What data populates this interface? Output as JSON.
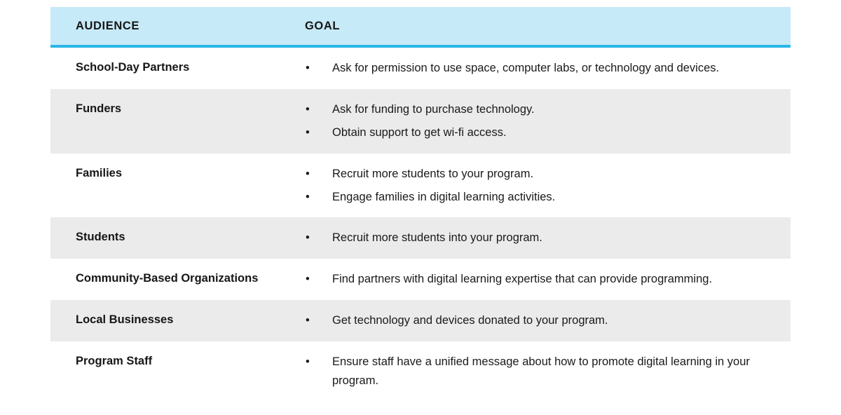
{
  "table": {
    "header": {
      "audience_label": "AUDIENCE",
      "goal_label": "GOAL",
      "background_color": "#c6eaf7",
      "accent_color": "#29b6e8"
    },
    "shaded_row_color": "#ebebeb",
    "bullet_glyph": "•",
    "rows": [
      {
        "audience": "School-Day Partners",
        "shaded": false,
        "goals": [
          "Ask for permission to use space, computer labs, or technology and devices."
        ]
      },
      {
        "audience": "Funders",
        "shaded": true,
        "goals": [
          "Ask for funding to purchase technology.",
          "Obtain support to get wi-fi access."
        ]
      },
      {
        "audience": "Families",
        "shaded": false,
        "goals": [
          "Recruit more students to your program.",
          "Engage families in digital learning activities."
        ]
      },
      {
        "audience": "Students",
        "shaded": true,
        "goals": [
          "Recruit more students into your program."
        ]
      },
      {
        "audience": "Community-Based Organizations",
        "shaded": false,
        "goals": [
          "Find partners with digital learning expertise that can provide programming."
        ]
      },
      {
        "audience": "Local Businesses",
        "shaded": true,
        "goals": [
          "Get technology and devices donated to your program."
        ]
      },
      {
        "audience": "Program Staff",
        "shaded": false,
        "goals": [
          "Ensure staff have a unified message about how to promote digital learning in your program."
        ]
      }
    ]
  }
}
